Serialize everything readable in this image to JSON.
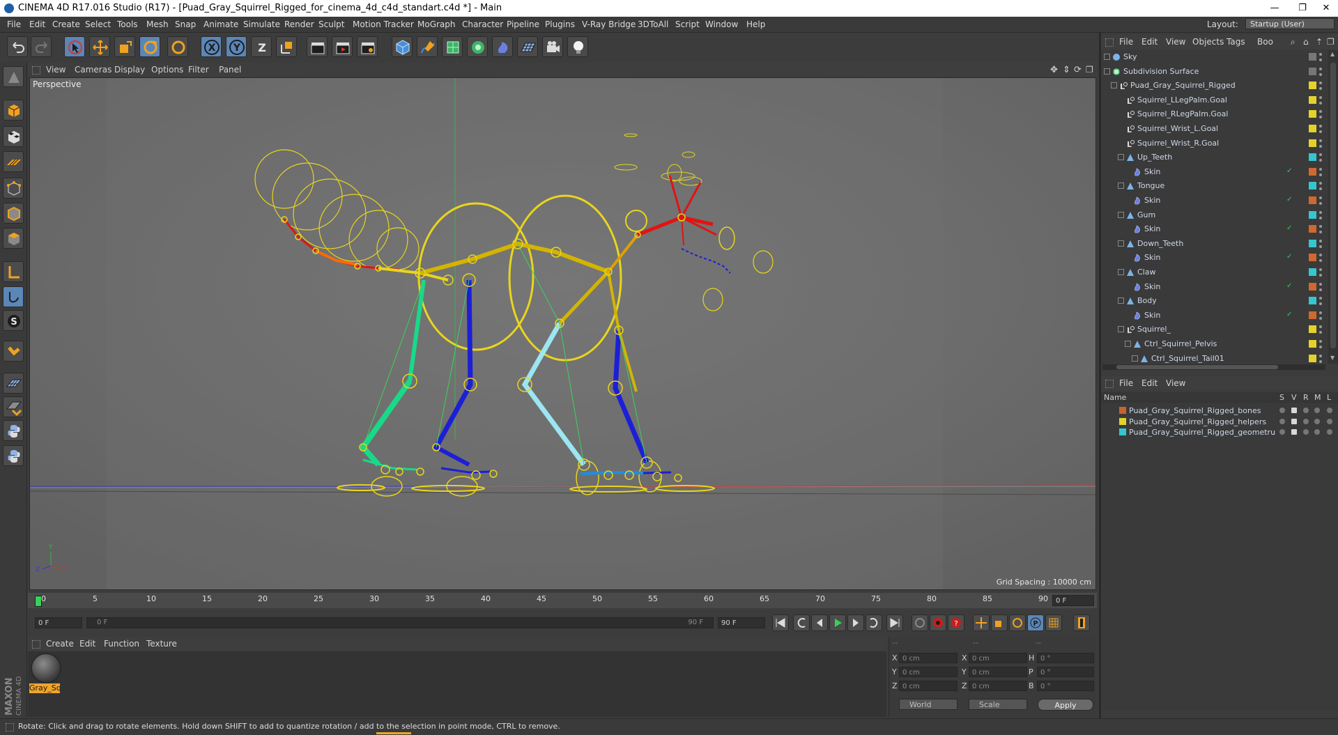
{
  "window": {
    "title": "CINEMA 4D R17.016 Studio (R17) - [Puad_Gray_Squirrel_Rigged_for_cinema_4d_c4d_standart.c4d *] - Main",
    "minimize": "—",
    "maximize": "❐",
    "close": "✕"
  },
  "menubar": {
    "items": [
      "File",
      "Edit",
      "Create",
      "Select",
      "Tools",
      "Mesh",
      "Snap",
      "Animate",
      "Simulate",
      "Render",
      "Sculpt",
      "Motion Tracker",
      "MoGraph",
      "Character",
      "Pipeline",
      "Plugins",
      "V-Ray Bridge",
      "3DToAll",
      "Script",
      "Window",
      "Help"
    ],
    "layout_label": "Layout:",
    "layout_value": "Startup (User)"
  },
  "toolbar": {
    "x_label": "X",
    "y_label": "Y",
    "z_label": "Z"
  },
  "viewport": {
    "menu": [
      "View",
      "Cameras",
      "Display",
      "Options",
      "Filter",
      "Panel"
    ],
    "label": "Perspective",
    "grid_spacing": "Grid Spacing : 10000 cm"
  },
  "timeline": {
    "ticks": [
      "0",
      "5",
      "10",
      "15",
      "20",
      "25",
      "30",
      "35",
      "40",
      "45",
      "50",
      "55",
      "60",
      "65",
      "70",
      "75",
      "80",
      "85",
      "90"
    ],
    "current_frame": "0 F",
    "start_field": "0 F",
    "range_start": "0 F",
    "range_end": "90 F",
    "end_field": "90 F"
  },
  "material_manager": {
    "menu": [
      "Create",
      "Edit",
      "Function",
      "Texture"
    ],
    "material_name": "Gray_Sq"
  },
  "coordinates": {
    "header_left": "--",
    "header_mid": "--",
    "header_right": "--",
    "rows": [
      {
        "a": "X",
        "av": "0 cm",
        "b": "X",
        "bv": "0 cm",
        "c": "H",
        "cv": "0 °"
      },
      {
        "a": "Y",
        "av": "0 cm",
        "b": "Y",
        "bv": "0 cm",
        "c": "P",
        "cv": "0 °"
      },
      {
        "a": "Z",
        "av": "0 cm",
        "b": "Z",
        "bv": "0 cm",
        "c": "B",
        "cv": "0 °"
      }
    ],
    "world": "World",
    "scale": "Scale",
    "apply": "Apply"
  },
  "object_manager": {
    "menu": [
      "File",
      "Edit",
      "View",
      "Objects",
      "Tags",
      "Boo"
    ],
    "rows": [
      {
        "label": "Sky",
        "indent": 0,
        "icon": "sky",
        "tag": "#777777"
      },
      {
        "label": "Subdivision Surface",
        "indent": 0,
        "icon": "subdiv",
        "tag": "#777777"
      },
      {
        "label": "Puad_Gray_Squirrel_Rigged",
        "indent": 1,
        "icon": "null",
        "tag": "#e3d22b"
      },
      {
        "label": "Squirrel_LLegPalm.Goal",
        "indent": 2,
        "icon": "null",
        "tag": "#e3d22b"
      },
      {
        "label": "Squirrel_RLegPalm.Goal",
        "indent": 2,
        "icon": "null",
        "tag": "#e3d22b"
      },
      {
        "label": "Squirrel_Wrist_L.Goal",
        "indent": 2,
        "icon": "null",
        "tag": "#e3d22b"
      },
      {
        "label": "Squirrel_Wrist_R.Goal",
        "indent": 2,
        "icon": "null",
        "tag": "#e3d22b"
      },
      {
        "label": "Up_Teeth",
        "indent": 2,
        "icon": "joint",
        "tag": "#35c6cf"
      },
      {
        "label": "Skin",
        "indent": 3,
        "icon": "skin",
        "tag": "#d0692f"
      },
      {
        "label": "Tongue",
        "indent": 2,
        "icon": "joint",
        "tag": "#35c6cf"
      },
      {
        "label": "Skin",
        "indent": 3,
        "icon": "skin",
        "tag": "#d0692f"
      },
      {
        "label": "Gum",
        "indent": 2,
        "icon": "joint",
        "tag": "#35c6cf"
      },
      {
        "label": "Skin",
        "indent": 3,
        "icon": "skin",
        "tag": "#d0692f"
      },
      {
        "label": "Down_Teeth",
        "indent": 2,
        "icon": "joint",
        "tag": "#35c6cf"
      },
      {
        "label": "Skin",
        "indent": 3,
        "icon": "skin",
        "tag": "#d0692f"
      },
      {
        "label": "Claw",
        "indent": 2,
        "icon": "joint",
        "tag": "#35c6cf"
      },
      {
        "label": "Skin",
        "indent": 3,
        "icon": "skin",
        "tag": "#d0692f"
      },
      {
        "label": "Body",
        "indent": 2,
        "icon": "joint",
        "tag": "#35c6cf"
      },
      {
        "label": "Skin",
        "indent": 3,
        "icon": "skin",
        "tag": "#d0692f"
      },
      {
        "label": "Squirrel_",
        "indent": 2,
        "icon": "null",
        "tag": "#e3d22b"
      },
      {
        "label": "Ctrl_Squirrel_Pelvis",
        "indent": 3,
        "icon": "joint",
        "tag": "#e3d22b"
      },
      {
        "label": "Ctrl_Squirrel_Tail01",
        "indent": 4,
        "icon": "joint",
        "tag": "#e3d22b"
      }
    ]
  },
  "layer_manager": {
    "menu": [
      "File",
      "Edit",
      "View"
    ],
    "columns": {
      "name": "Name",
      "s": "S",
      "v": "V",
      "r": "R",
      "m": "M",
      "l": "L"
    },
    "layers": [
      {
        "name": "Puad_Gray_Squirrel_Rigged_bones",
        "color": "#c8642c"
      },
      {
        "name": "Puad_Gray_Squirrel_Rigged_helpers",
        "color": "#e3d22b"
      },
      {
        "name": "Puad_Gray_Squirrel_Rigged_geometru",
        "color": "#35c6cf"
      }
    ]
  },
  "status": {
    "text": "Rotate: Click and drag to rotate elements. Hold down SHIFT to add to quantize rotation / add to the selection in point mode, CTRL to remove."
  },
  "colors": {
    "accent": "#5b86b8",
    "rig_yellow": "#e8d51d",
    "bone_blue": "#1c1fd6",
    "bone_green": "#19d989",
    "bone_red": "#e01414",
    "bone_lightblue": "#9be6f0"
  }
}
